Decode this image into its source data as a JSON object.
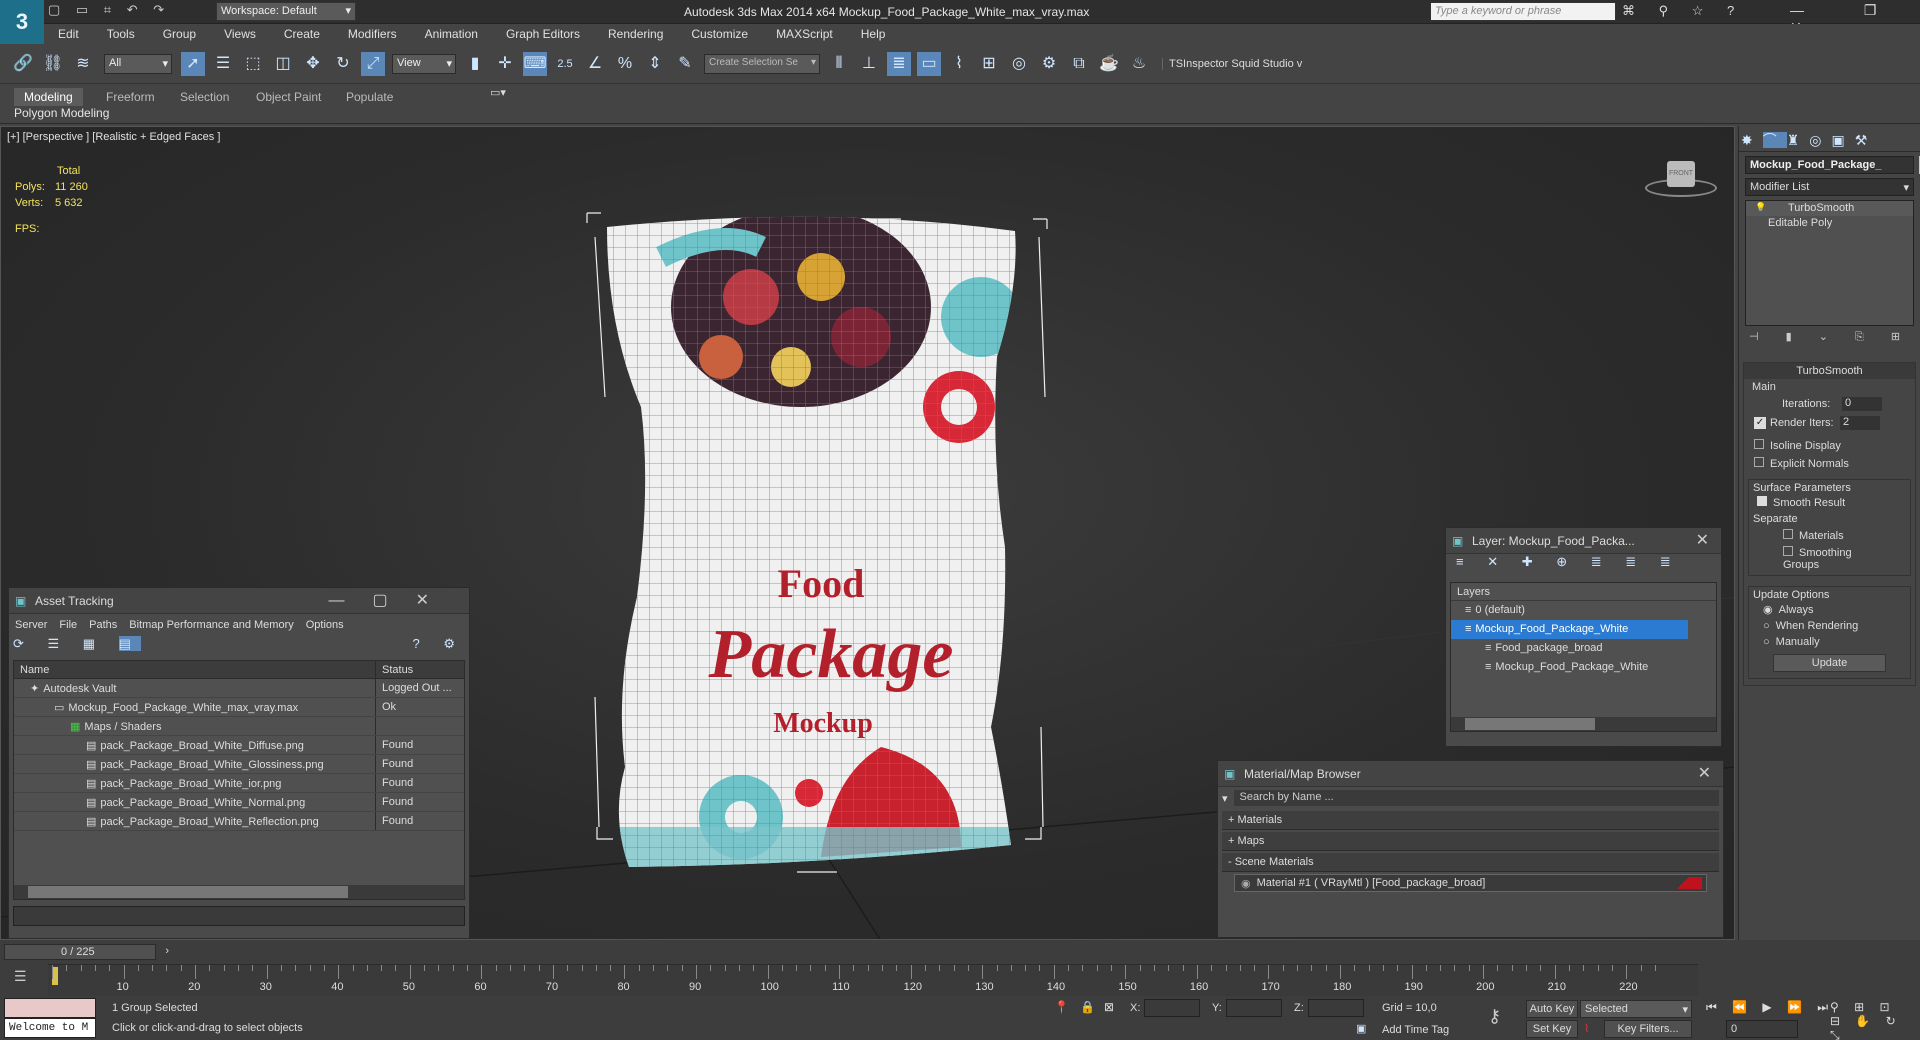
{
  "app": {
    "title": "Autodesk 3ds Max  2014 x64     Mockup_Food_Package_White_max_vray.max",
    "workspace": "Workspace: Default",
    "search_placeholder": "Type a keyword or phrase"
  },
  "menu": [
    "Edit",
    "Tools",
    "Group",
    "Views",
    "Create",
    "Modifiers",
    "Animation",
    "Graph Editors",
    "Rendering",
    "Customize",
    "MAXScript",
    "Help"
  ],
  "toolbar": {
    "filter_value": "All",
    "view_value": "View",
    "selection_set_placeholder": "Create Selection Se",
    "snap_value": "2.5",
    "plugins": "TSInspector  Squid Studio v"
  },
  "ribbon": {
    "tabs": [
      "Modeling",
      "Freeform",
      "Selection",
      "Object Paint",
      "Populate"
    ],
    "sublabel": "Polygon Modeling"
  },
  "viewport": {
    "label": "[+] [Perspective ] [Realistic + Edged Faces ]",
    "stats": {
      "total": "Total",
      "polys_label": "Polys:",
      "polys": "11 260",
      "verts_label": "Verts:",
      "verts": "5 632",
      "fps_label": "FPS:"
    },
    "viewcube": "FRONT",
    "bag_text": {
      "line1": "Food",
      "line2": "Package",
      "line3": "Mockup"
    }
  },
  "asset_tracking": {
    "title": "Asset Tracking",
    "menu": [
      "Server",
      "File",
      "Paths",
      "Bitmap Performance and Memory",
      "Options"
    ],
    "columns": [
      "Name",
      "Status"
    ],
    "rows": [
      {
        "name": "Autodesk Vault",
        "status": "Logged Out ..."
      },
      {
        "name": "Mockup_Food_Package_White_max_vray.max",
        "status": "Ok"
      },
      {
        "name": "Maps / Shaders",
        "status": ""
      },
      {
        "name": "pack_Package_Broad_White_Diffuse.png",
        "status": "Found"
      },
      {
        "name": "pack_Package_Broad_White_Glossiness.png",
        "status": "Found"
      },
      {
        "name": "pack_Package_Broad_White_ior.png",
        "status": "Found"
      },
      {
        "name": "pack_Package_Broad_White_Normal.png",
        "status": "Found"
      },
      {
        "name": "pack_Package_Broad_White_Reflection.png",
        "status": "Found"
      }
    ]
  },
  "layer_panel": {
    "title": "Layer: Mockup_Food_Packa...",
    "header": "Layers",
    "items": [
      "0 (default)",
      "Mockup_Food_Package_White",
      "Food_package_broad",
      "Mockup_Food_Package_White"
    ]
  },
  "material_browser": {
    "title": "Material/Map Browser",
    "search_placeholder": "Search by Name ...",
    "sections": [
      "+ Materials",
      "+ Maps",
      "- Scene Materials"
    ],
    "material": "Material #1  ( VRayMtl ) [Food_package_broad]"
  },
  "command_panel": {
    "object_name": "Mockup_Food_Package_",
    "modifier_list": "Modifier List",
    "stack": [
      "TurboSmooth",
      "Editable Poly"
    ],
    "rollout": {
      "title": "TurboSmooth",
      "main": "Main",
      "iterations_label": "Iterations:",
      "iterations": "0",
      "render_iters_label": "Render Iters:",
      "render_iters": "2",
      "isoline": "Isoline Display",
      "explicit": "Explicit Normals",
      "surface": "Surface Parameters",
      "smooth_result": "Smooth Result",
      "separate": "Separate",
      "materials": "Materials",
      "smoothing_groups": "Smoothing Groups",
      "update_options": "Update Options",
      "always": "Always",
      "when_rendering": "When Rendering",
      "manually": "Manually",
      "update": "Update"
    }
  },
  "timeline": {
    "frame": "0 / 225",
    "ticks": [
      "10",
      "20",
      "30",
      "40",
      "50",
      "60",
      "70",
      "80",
      "90",
      "100",
      "110",
      "120",
      "130",
      "140",
      "150",
      "160",
      "170",
      "180",
      "190",
      "200",
      "210",
      "220"
    ]
  },
  "status": {
    "script": "Welcome to M",
    "selected": "1 Group Selected",
    "prompt": "Click or click-and-drag to select objects",
    "x_label": "X:",
    "y_label": "Y:",
    "z_label": "Z:",
    "grid": "Grid = 10,0",
    "add_time_tag": "Add Time Tag",
    "auto_key": "Auto Key",
    "set_key": "Set Key",
    "key_mode": "Selected",
    "key_filters": "Key Filters...",
    "frame_value": "0"
  }
}
